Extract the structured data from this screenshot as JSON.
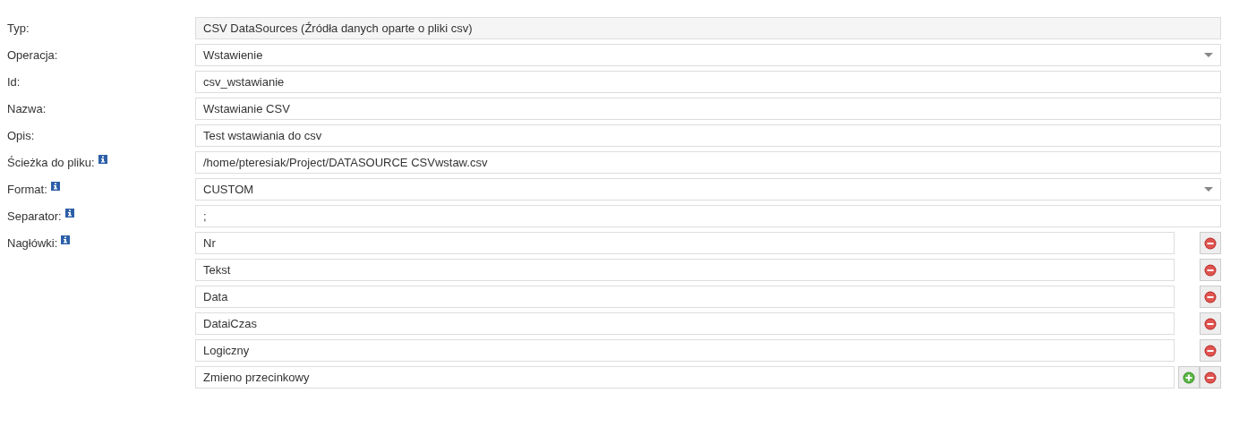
{
  "fields": [
    {
      "label": "Typ:",
      "kind": "readonly",
      "help": false,
      "value": "CSV DataSources (Źródła danych oparte o pliki csv)"
    },
    {
      "label": "Operacja:",
      "kind": "select",
      "help": false,
      "value": "Wstawienie"
    },
    {
      "label": "Id:",
      "kind": "text",
      "help": false,
      "value": "csv_wstawianie"
    },
    {
      "label": "Nazwa:",
      "kind": "text",
      "help": false,
      "value": "Wstawianie CSV"
    },
    {
      "label": "Opis:",
      "kind": "text",
      "help": false,
      "value": "Test wstawiania do csv"
    },
    {
      "label": "Ścieżka do pliku:",
      "kind": "text",
      "help": true,
      "value": "/home/pteresiak/Project/DATASOURCE CSVwstaw.csv"
    },
    {
      "label": "Format:",
      "kind": "select",
      "help": true,
      "value": "CUSTOM"
    },
    {
      "label": "Separator:",
      "kind": "text",
      "help": true,
      "value": ";"
    },
    {
      "label": "Nagłówki:",
      "kind": "list",
      "help": true,
      "items": [
        {
          "value": "Nr",
          "can_add": false
        },
        {
          "value": "Tekst",
          "can_add": false
        },
        {
          "value": "Data",
          "can_add": false
        },
        {
          "value": "DataiCzas",
          "can_add": false
        },
        {
          "value": "Logiczny",
          "can_add": false
        },
        {
          "value": "Zmieno przecinkowy",
          "can_add": true
        }
      ]
    }
  ]
}
